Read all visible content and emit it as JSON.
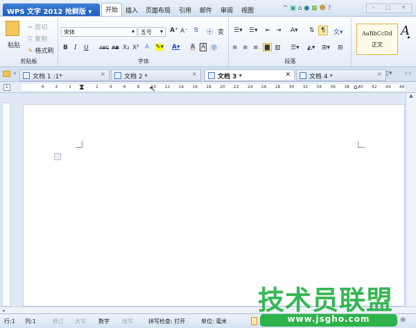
{
  "app": {
    "title": "WPS 文字 2012 抢鲜版"
  },
  "menu": [
    "开始",
    "插入",
    "页面布局",
    "引用",
    "邮件",
    "审阅",
    "视图"
  ],
  "ribbon": {
    "clipboard": {
      "paste": "粘贴",
      "cut": "剪切",
      "copy": "复制",
      "format_painter": "格式刷",
      "label": "剪贴板"
    },
    "font": {
      "font_name": "宋体",
      "font_size": "五号",
      "bold": "B",
      "italic": "I",
      "underline": "U",
      "strike": "ABC",
      "double_strike": "AB",
      "subscript": "X₂",
      "superscript": "X²",
      "grow": "A",
      "shrink": "A",
      "label": "字体"
    },
    "paragraph": {
      "label": "段落"
    },
    "styles": {
      "preview": "AaBbCcDd",
      "name": "正文"
    }
  },
  "tabs": [
    {
      "label": "文档 1 :1*",
      "active": false
    },
    {
      "label": "文档 2 *",
      "active": false
    },
    {
      "label": "文档 3 *",
      "active": true
    },
    {
      "label": "文档 4 *",
      "active": false
    }
  ],
  "ruler": {
    "ticks": [
      "6",
      "4",
      "2",
      "2",
      "4",
      "6",
      "8",
      "10",
      "12",
      "14",
      "16",
      "18",
      "20",
      "22",
      "24",
      "26",
      "28",
      "30",
      "32",
      "34",
      "36",
      "38",
      "40",
      "42",
      "44",
      "46"
    ]
  },
  "status": {
    "row": "行:1",
    "col": "列:1",
    "revise": "修订",
    "caps": "大写",
    "num": "数字",
    "overwrite": "改写",
    "spell": "拼写检查: 打开",
    "unit": "单位: 毫米"
  },
  "watermark": {
    "text": "技术员联盟",
    "url": "www.jsgho.com",
    "color": "#2db34a"
  }
}
